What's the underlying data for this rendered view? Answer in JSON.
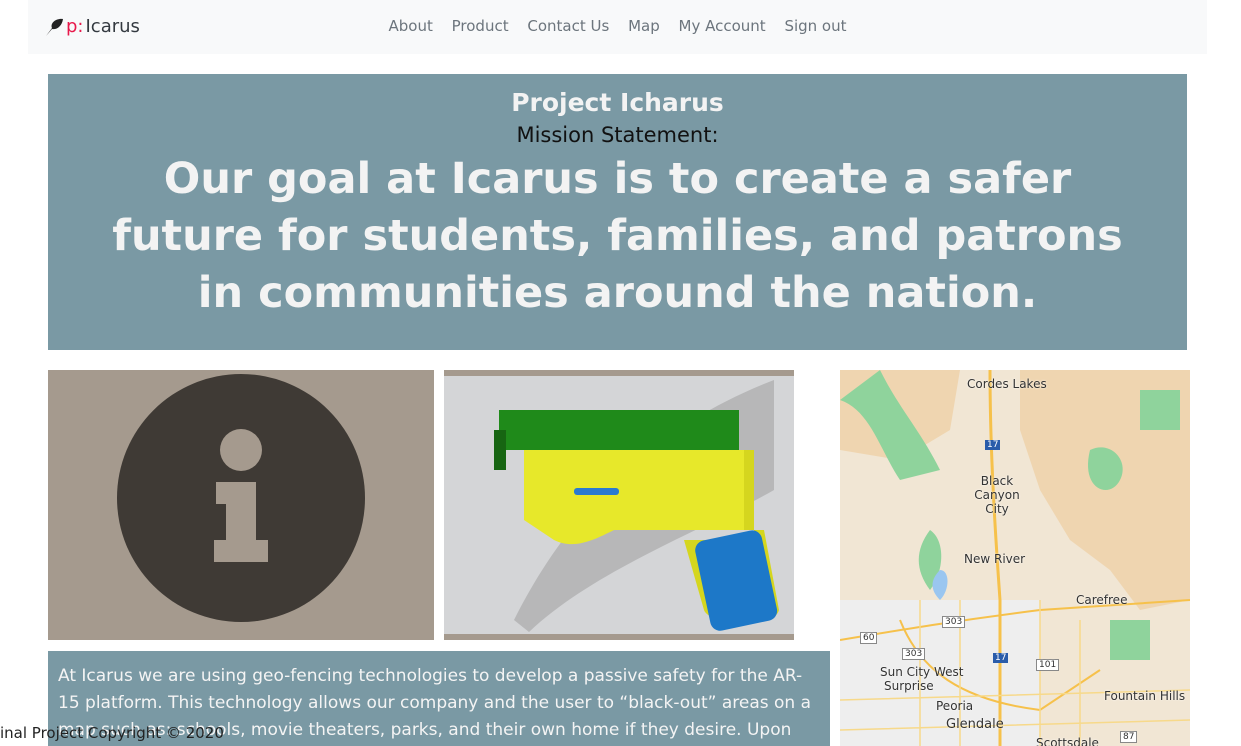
{
  "brand": {
    "prefix": "p:",
    "name": "Icarus",
    "icon": "feather-icon",
    "accent": "#e8194b"
  },
  "nav": [
    "About",
    "Product",
    "Contact Us",
    "Map",
    "My Account",
    "Sign out"
  ],
  "hero": {
    "title": "Project Icharus",
    "subtitle": "Mission Statement:",
    "statement": "Our goal at Icarus is to create a safer future for students, families, and patrons in communities around the nation."
  },
  "images": {
    "info_icon": "info-circle-icon",
    "product": "ar15-lower-receiver-render"
  },
  "map": {
    "labels": [
      "Cordes Lakes",
      "Black Canyon City",
      "New River",
      "Carefree",
      "Sun City West",
      "Surprise",
      "Peoria",
      "Glendale",
      "Fountain Hills",
      "Scottsdale"
    ],
    "shields": [
      "17",
      "303",
      "60",
      "101",
      "17",
      "87",
      "303"
    ]
  },
  "body_text": "At Icarus we are using geo-fencing technologies to develop a passive safety for the AR-15 platform. This technology allows our company and the user to “black-out” areas on a map such as: schools, movie theaters, parks, and their own home if they desire. Upon implementation of",
  "footer": "inal Project Copyright © 2020"
}
